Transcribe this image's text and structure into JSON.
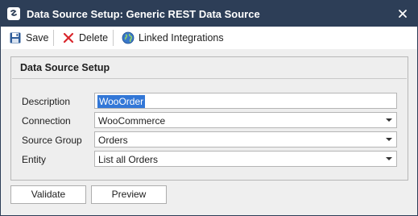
{
  "window": {
    "title": "Data Source Setup: Generic REST Data Source",
    "close_icon": "close-icon",
    "app_icon": "data-source-icon"
  },
  "toolbar": {
    "save_label": "Save",
    "delete_label": "Delete",
    "linked_label": "Linked Integrations",
    "icons": {
      "save": "floppy-disk-icon",
      "delete": "red-x-icon",
      "linked": "globe-icon"
    }
  },
  "group": {
    "title": "Data Source Setup",
    "fields": [
      {
        "label": "Description",
        "value": "WooOrder",
        "type": "text",
        "selected": true
      },
      {
        "label": "Connection",
        "value": "WooCommerce",
        "type": "select"
      },
      {
        "label": "Source Group",
        "value": "Orders",
        "type": "select"
      },
      {
        "label": "Entity",
        "value": "List all Orders",
        "type": "select"
      }
    ]
  },
  "buttons": {
    "validate_label": "Validate",
    "preview_label": "Preview"
  },
  "colors": {
    "titlebar": "#2d3e57",
    "selection": "#3277d7",
    "panel": "#efefef"
  }
}
